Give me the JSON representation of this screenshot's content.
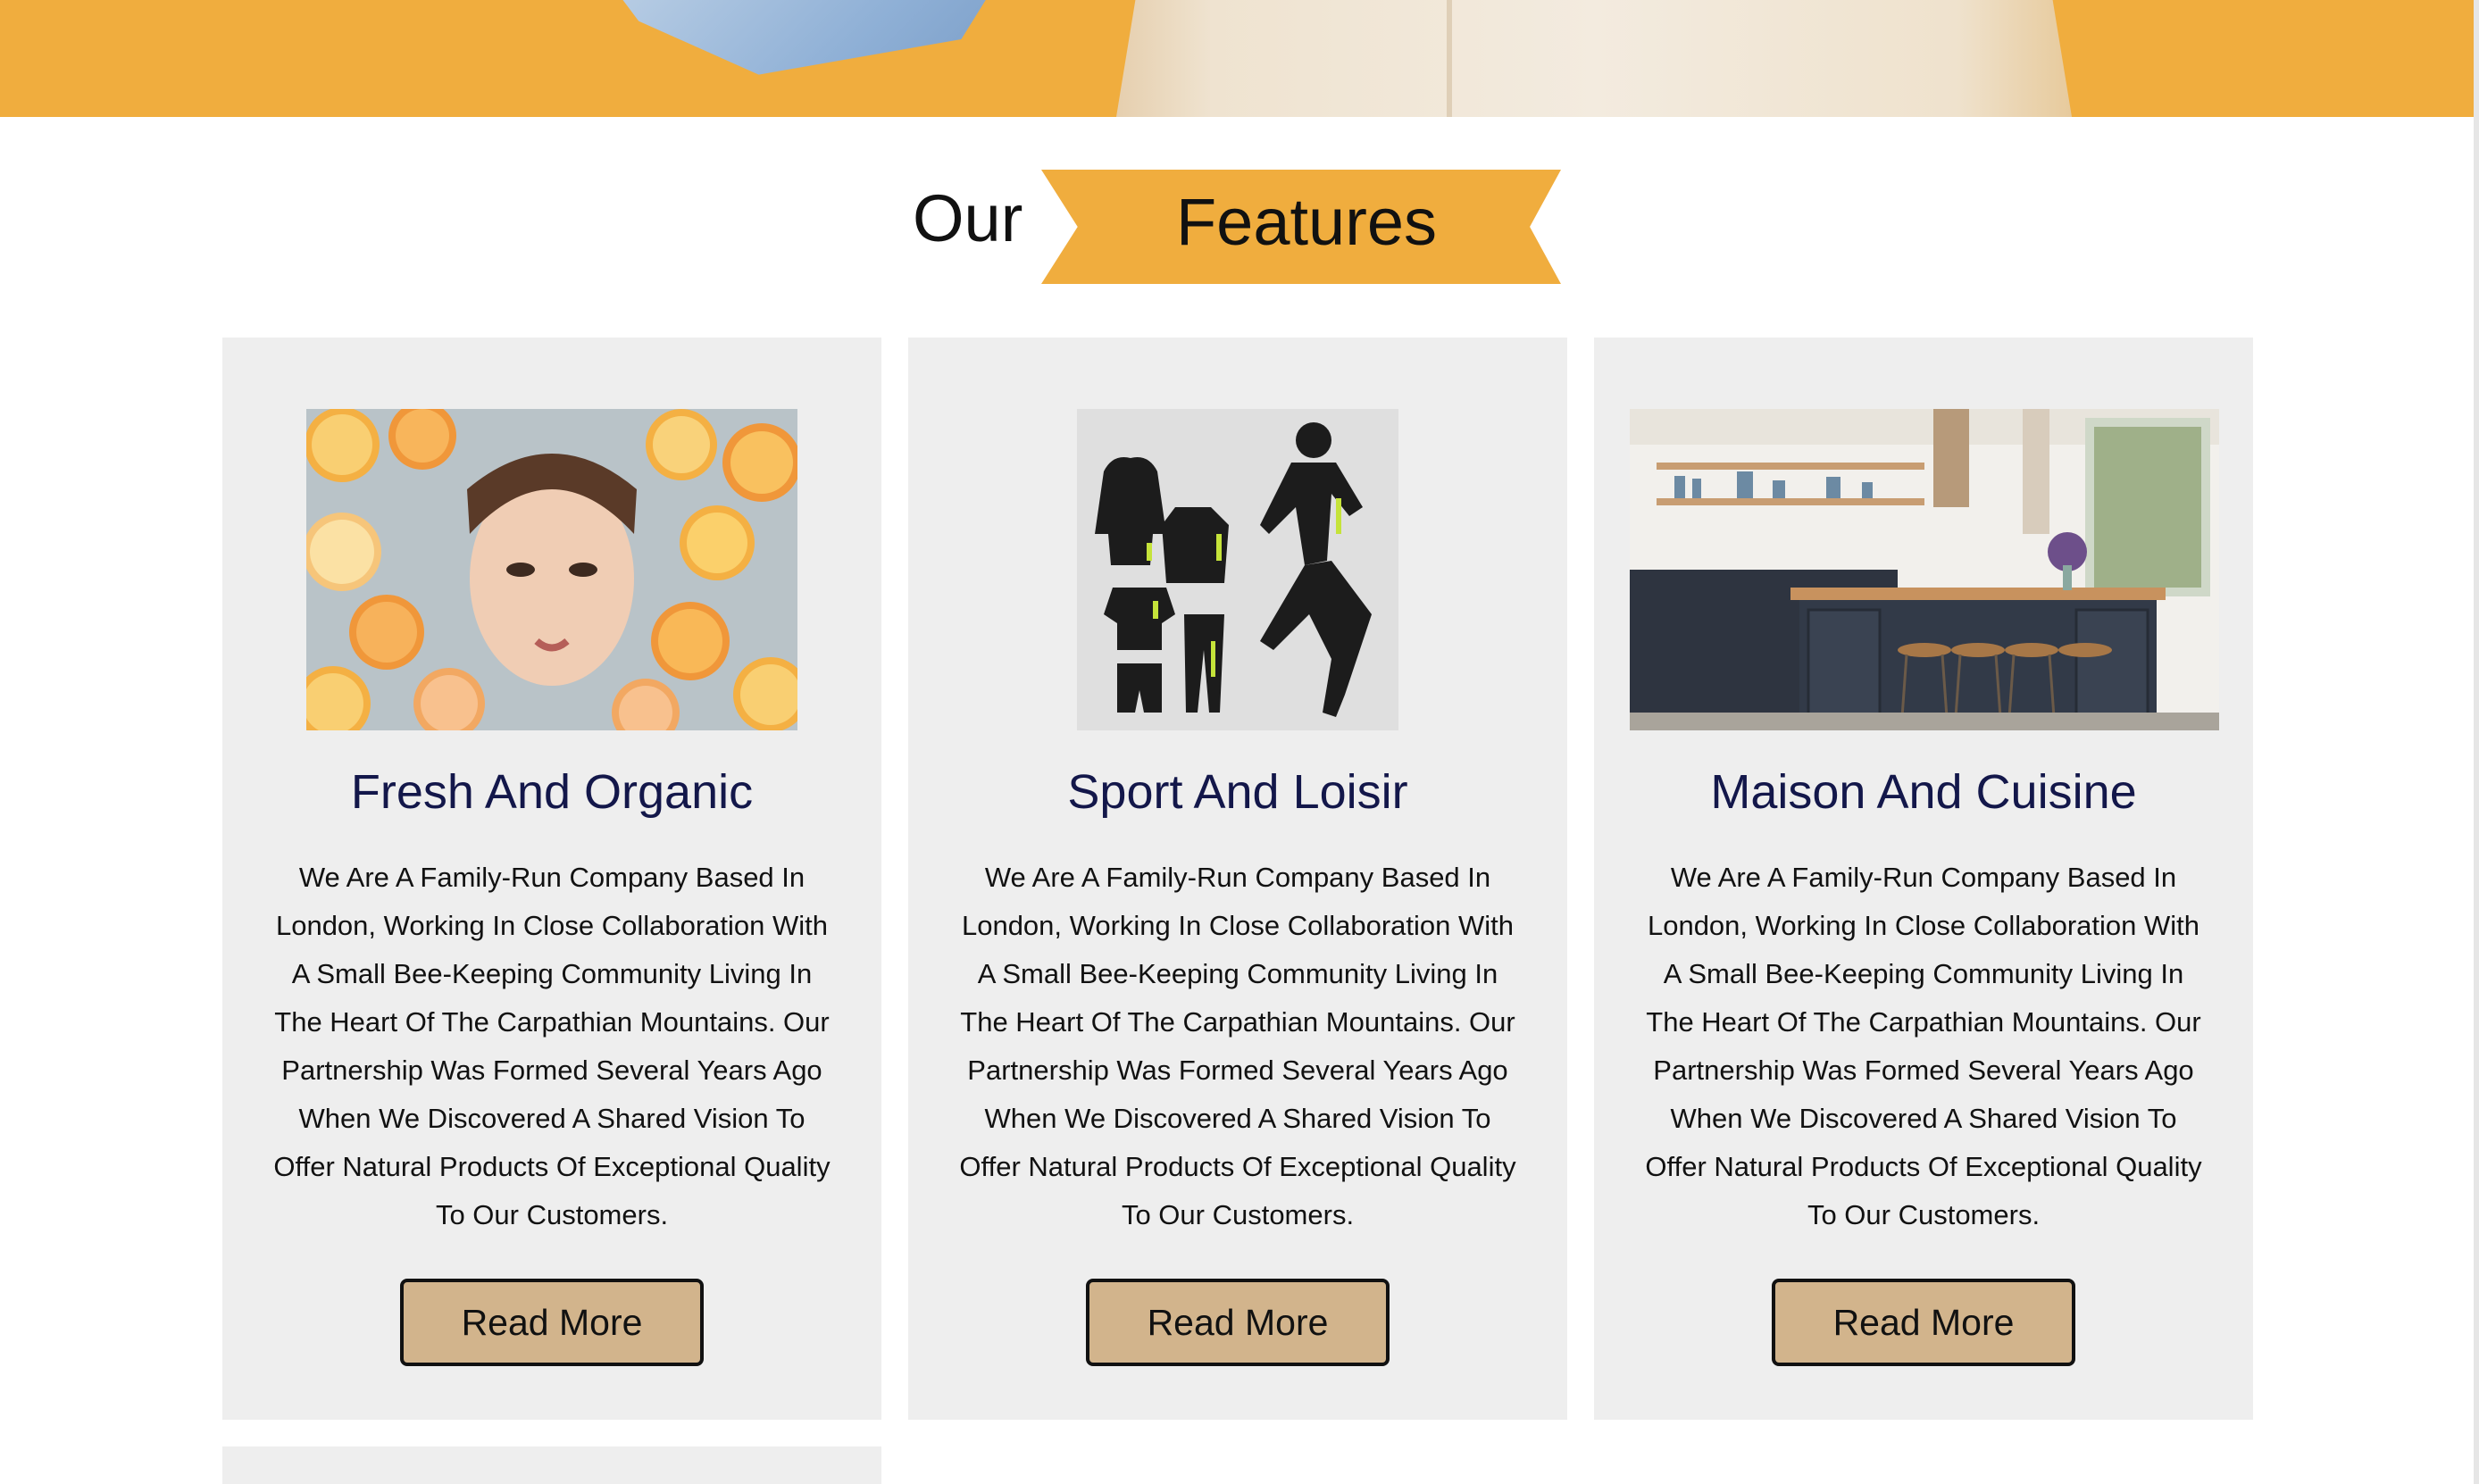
{
  "hero": {
    "image_description": "hero-banner-image",
    "colors": {
      "background": "#f0ad3e",
      "accent": "#8fb0d6"
    }
  },
  "section": {
    "title_word_1": "Our",
    "title_word_2": "Features",
    "ribbon_color": "#f0ad3e"
  },
  "cards": [
    {
      "image_name": "citrus-face-photo",
      "title": "Fresh And Organic",
      "text": "We Are A Family-Run Company Based In London, Working In Close Collaboration With A Small Bee-Keeping Community Living In The Heart Of The Carpathian Mountains. Our Partnership Was Formed Several Years Ago When We Discovered A Shared Vision To Offer Natural Products Of Exceptional Quality To Our Customers.",
      "button_label": "Read More"
    },
    {
      "image_name": "sportswear-photo",
      "title": "Sport And Loisir",
      "text": "We Are A Family-Run Company Based In London, Working In Close Collaboration With A Small Bee-Keeping Community Living In The Heart Of The Carpathian Mountains. Our Partnership Was Formed Several Years Ago When We Discovered A Shared Vision To Offer Natural Products Of Exceptional Quality To Our Customers.",
      "button_label": "Read More"
    },
    {
      "image_name": "kitchen-photo",
      "title": "Maison And Cuisine",
      "text": "We Are A Family-Run Company Based In London, Working In Close Collaboration With A Small Bee-Keeping Community Living In The Heart Of The Carpathian Mountains. Our Partnership Was Formed Several Years Ago When We Discovered A Shared Vision To Offer Natural Products Of Exceptional Quality To Our Customers.",
      "button_label": "Read More"
    }
  ],
  "colors": {
    "card_background": "#eeeeee",
    "card_title": "#13174a",
    "button_background": "#d2b48c",
    "button_border": "#111111"
  }
}
